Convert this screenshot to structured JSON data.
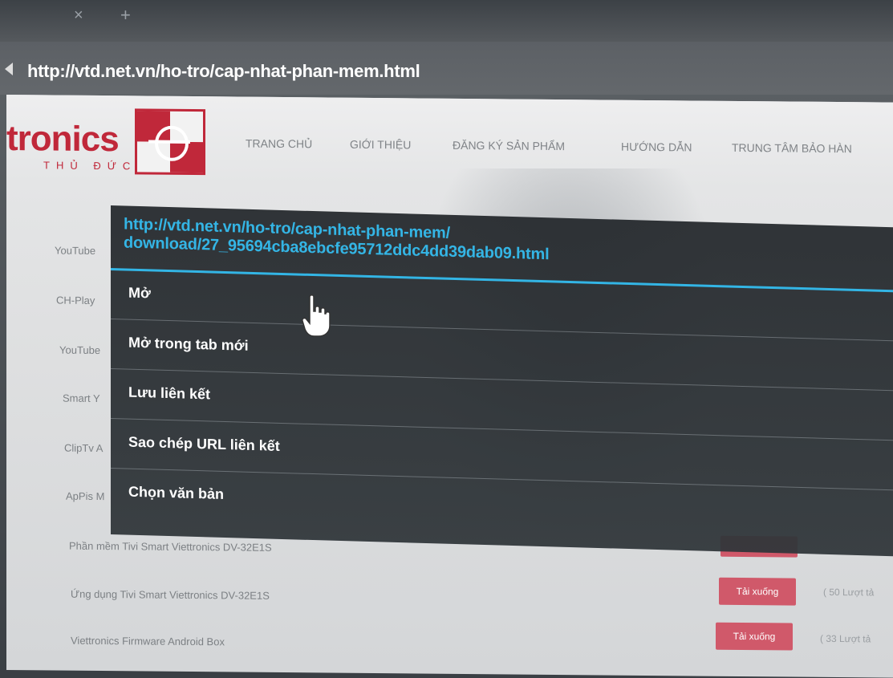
{
  "browser": {
    "tab_close": "×",
    "tab_new": "+",
    "url": "http://vtd.net.vn/ho-tro/cap-nhat-phan-mem.html"
  },
  "site": {
    "logo_text": "tronics",
    "logo_sub": "THỦ ĐỨC",
    "nav": [
      "TRANG CHỦ",
      "GIỚI THIỆU",
      "ĐĂNG KÝ SẢN PHẨM",
      "HƯỚNG DẪN",
      "TRUNG TÂM BẢO HÀN"
    ]
  },
  "list": {
    "side_labels": [
      "YouTube",
      "CH-Play",
      "YouTube",
      "Smart Y",
      "ClipTv A",
      "ApPis M"
    ],
    "rows": [
      {
        "label": "Phần mềm Tivi Smart Viettronics DV-32E1S",
        "button": "",
        "count": ""
      },
      {
        "label": "Ứng dụng Tivi Smart Viettronics DV-32E1S",
        "button": "Tải xuống",
        "count": "( 50 Lượt tả"
      },
      {
        "label": "Viettronics Firmware Android Box",
        "button": "Tải xuống",
        "count": "( 33 Lượt tả"
      }
    ]
  },
  "context_menu": {
    "link_url_line1": "http://vtd.net.vn/ho-tro/cap-nhat-phan-mem/",
    "link_url_line2": "download/27_95694cba8ebcfe95712ddc4dd39dab09.html",
    "items": [
      "Mở",
      "Mở trong tab mới",
      "Lưu liên kết",
      "Sao chép URL liên kết",
      "Chọn văn bản"
    ]
  },
  "colors": {
    "accent": "#33b5e5",
    "brand_red": "#c0283a",
    "button_red": "#d0596a"
  },
  "icons": {
    "cursor": "hand-pointer-icon",
    "back": "back-arrow-icon"
  }
}
